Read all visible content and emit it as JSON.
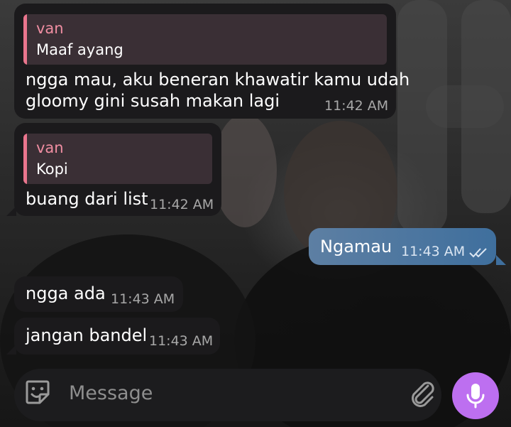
{
  "messages": [
    {
      "reply_name": "van",
      "reply_text": "Maaf ayang",
      "line1": "ngga mau, aku beneran khawatir kamu udah",
      "line2": "gloomy gini susah makan lagi",
      "time": "11:42 AM"
    },
    {
      "reply_name": "van",
      "reply_text": "Kopi",
      "line1": "buang dari list",
      "time": "11:42 AM"
    },
    {
      "text": "Ngamau",
      "time": "11:43 AM",
      "status": "read-double-check"
    },
    {
      "text": "ngga ada",
      "time": "11:43 AM"
    },
    {
      "text": "jangan bandel",
      "time": "11:43 AM"
    }
  ],
  "composer": {
    "placeholder": "Message"
  },
  "icons": {
    "sticker": "sticker-icon",
    "attach": "paperclip-icon",
    "mic": "microphone-icon",
    "read": "double-check-icon"
  },
  "colors": {
    "incoming_bubble": "#1b1a1c",
    "outgoing_bubble": "#4f78a0",
    "reply_accent": "#e9758d",
    "mic_button": "#bd6ff0"
  }
}
